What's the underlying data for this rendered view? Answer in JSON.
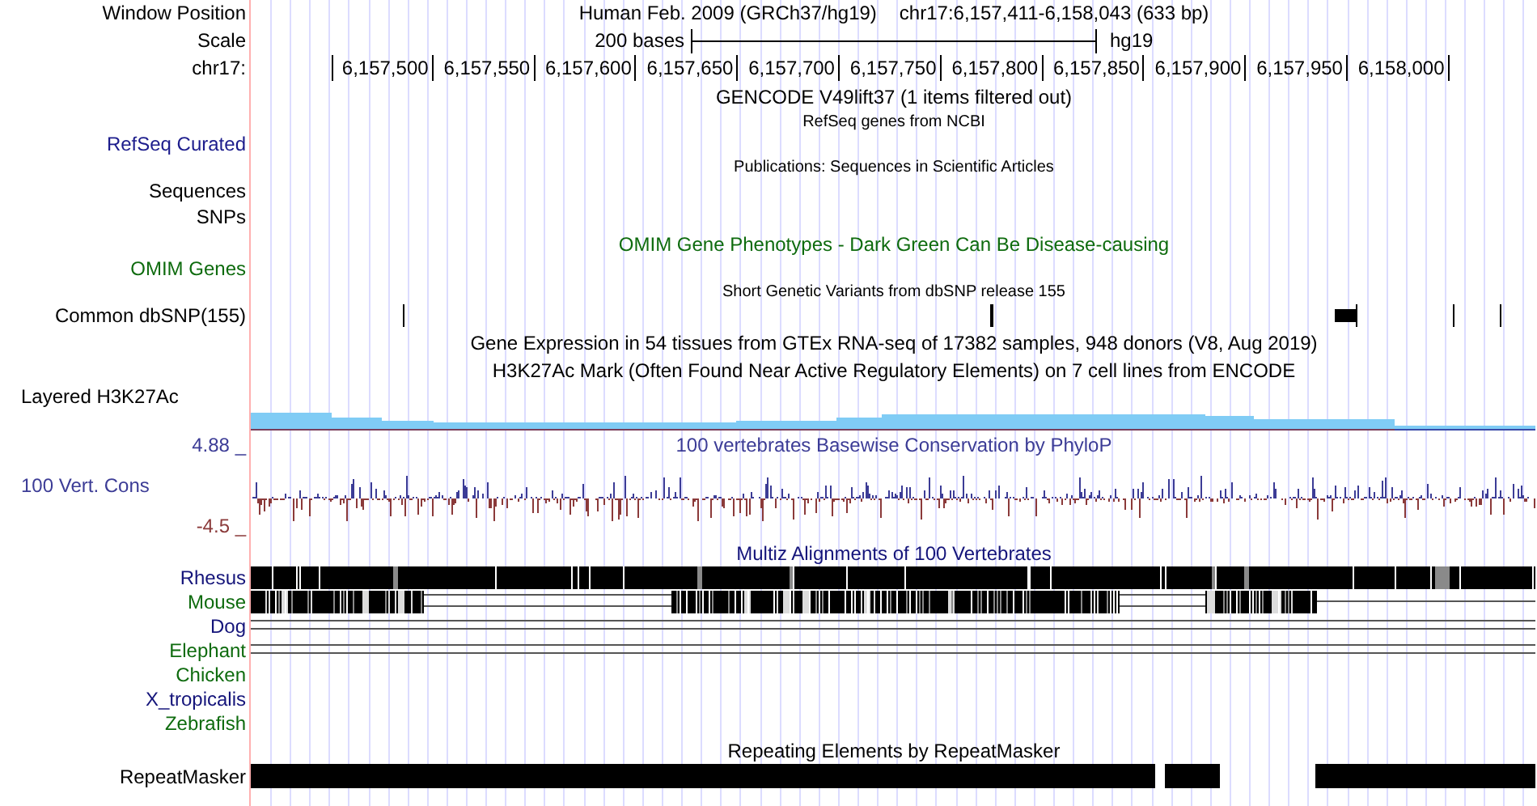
{
  "position": {
    "label": "Window Position",
    "genome": "Human Feb. 2009 (GRCh37/hg19)",
    "range": "chr17:6,157,411-6,158,043 (633 bp)"
  },
  "scale": {
    "label": "Scale",
    "length": "200 bases",
    "assembly": "hg19"
  },
  "ruler": {
    "label": "chr17:",
    "ticks": [
      "6,157,500",
      "6,157,550",
      "6,157,600",
      "6,157,650",
      "6,157,700",
      "6,157,750",
      "6,157,800",
      "6,157,850",
      "6,157,900",
      "6,157,950",
      "6,158,000"
    ]
  },
  "tracks": [
    {
      "kind": "title",
      "text": "GENCODE V49lift37 (1 items filtered out)",
      "color": "#000000"
    },
    {
      "kind": "caption",
      "text": "RefSeq genes from NCBI"
    },
    {
      "kind": "label",
      "labels": [
        "RefSeq Curated"
      ],
      "color": "#1c1c8c"
    },
    {
      "kind": "caption",
      "text": "Publications: Sequences in Scientific Articles"
    },
    {
      "kind": "label",
      "labels": [
        "Sequences",
        "SNPs"
      ],
      "color": "#000000"
    },
    {
      "kind": "title",
      "text": "OMIM Gene Phenotypes - Dark Green Can Be Disease-causing",
      "color": "#0e6b0e"
    },
    {
      "kind": "label",
      "labels": [
        "OMIM Genes"
      ],
      "color": "#0e6b0e"
    },
    {
      "kind": "caption",
      "text": "Short Genetic Variants from dbSNP release 155"
    },
    {
      "kind": "variants",
      "labels": [
        "Common dbSNP(155)"
      ],
      "color": "#000000"
    },
    {
      "kind": "title",
      "text": "Gene Expression in 54 tissues from GTEx RNA-seq of 17382 samples, 948 donors (V8, Aug 2019)",
      "color": "#000000"
    },
    {
      "kind": "title",
      "text": "H3K27Ac Mark (Often Found Near Active Regulatory Elements) on 7 cell lines from ENCODE",
      "color": "#000000"
    },
    {
      "kind": "signal",
      "labels": [
        "Layered H3K27Ac"
      ],
      "color": "#000000"
    },
    {
      "kind": "conservation",
      "title": "100 vertebrates Basewise Conservation by PhyloP",
      "color": "#3c3c96",
      "max": "4.88 _",
      "labels": [
        "100 Vert. Cons"
      ],
      "min": {
        "text": "-4.5 _",
        "color": "#8b3a3a"
      }
    },
    {
      "kind": "title",
      "text": "Multiz Alignments of 100 Vertebrates",
      "color": "#14147a"
    },
    {
      "kind": "alignment",
      "species": [
        {
          "label": "Rhesus",
          "color": "#14147a",
          "kind": "full"
        },
        {
          "label": "Mouse",
          "color": "#0e6b0e",
          "kind": "partial"
        },
        {
          "label": "Dog",
          "color": "#14147a",
          "kind": "gaps"
        },
        {
          "label": "Elephant",
          "color": "#0e6b0e",
          "kind": "gaps"
        },
        {
          "label": "Chicken",
          "color": "#0e6b0e",
          "kind": "none"
        },
        {
          "label": "X_tropicalis",
          "color": "#14147a",
          "kind": "none"
        },
        {
          "label": "Zebrafish",
          "color": "#0e6b0e",
          "kind": "none"
        }
      ]
    },
    {
      "kind": "title",
      "text": "Repeating Elements by RepeatMasker",
      "color": "#000000"
    },
    {
      "kind": "repeats",
      "labels": [
        "RepeatMasker"
      ],
      "color": "#000000"
    }
  ]
}
